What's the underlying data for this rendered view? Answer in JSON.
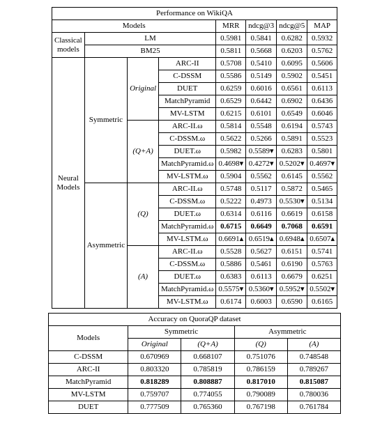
{
  "table1": {
    "title": "Performance on WikiQA",
    "hdr_models": "Models",
    "metrics": {
      "m1": "MRR",
      "m2": "ndcg@3",
      "m3": "ndcg@5",
      "m4": "MAP"
    },
    "classical_group": "Classical\nmodels",
    "neural_group": "Neural\nModels",
    "classical": {
      "lm": {
        "name": "LM",
        "v": [
          "0.5981",
          "0.5841",
          "0.6282",
          "0.5932"
        ]
      },
      "bm25": {
        "name": "BM25",
        "v": [
          "0.5811",
          "0.5668",
          "0.6203",
          "0.5762"
        ]
      }
    },
    "sym_label": "Symmetric",
    "asym_label": "Asymmetric",
    "sub_original": "Original",
    "sub_qa": "(Q+A)",
    "sub_q": "(Q)",
    "sub_a": "(A)",
    "rows": {
      "so_arc": {
        "name": "ARC-II",
        "v": [
          "0.5708",
          "0.5410",
          "0.6095",
          "0.5606"
        ]
      },
      "so_cds": {
        "name": "C-DSSM",
        "v": [
          "0.5586",
          "0.5149",
          "0.5902",
          "0.5451"
        ]
      },
      "so_duet": {
        "name": "DUET",
        "v": [
          "0.6259",
          "0.6016",
          "0.6561",
          "0.6113"
        ]
      },
      "so_mp": {
        "name": "MatchPyramid",
        "v": [
          "0.6529",
          "0.6442",
          "0.6902",
          "0.6436"
        ]
      },
      "so_mv": {
        "name": "MV-LSTM",
        "v": [
          "0.6215",
          "0.6101",
          "0.6549",
          "0.6046"
        ]
      },
      "sqa_arc": {
        "name": "ARC-II.ω",
        "v": [
          "0.5814",
          "0.5548",
          "0.6194",
          "0.5743"
        ]
      },
      "sqa_cds": {
        "name": "C-DSSM.ω",
        "v": [
          "0.5622",
          "0.5266",
          "0.5891",
          "0.5523"
        ]
      },
      "sqa_duet": {
        "name": "DUET.ω",
        "v": [
          "0.5982",
          "0.5589▾",
          "0.6283",
          "0.5801"
        ]
      },
      "sqa_mp": {
        "name": "MatchPyramid.ω",
        "v": [
          "0.4698▾",
          "0.4272▾",
          "0.5202▾",
          "0.4697▾"
        ]
      },
      "sqa_mv": {
        "name": "MV-LSTM.ω",
        "v": [
          "0.5904",
          "0.5562",
          "0.6145",
          "0.5562"
        ]
      },
      "aq_arc": {
        "name": "ARC-II.ω",
        "v": [
          "0.5748",
          "0.5117",
          "0.5872",
          "0.5465"
        ]
      },
      "aq_cds": {
        "name": "C-DSSM.ω",
        "v": [
          "0.5222",
          "0.4973",
          "0.5530▾",
          "0.5134"
        ]
      },
      "aq_duet": {
        "name": "DUET.ω",
        "v": [
          "0.6314",
          "0.6116",
          "0.6619",
          "0.6158"
        ]
      },
      "aq_mp": {
        "name": "MatchPyramid.ω",
        "v": [
          "0.6715",
          "0.6649",
          "0.7068",
          "0.6591"
        ]
      },
      "aq_mv": {
        "name": "MV-LSTM.ω",
        "v": [
          "0.6691▴",
          "0.6519▴",
          "0.6948▴",
          "0.6507▴"
        ]
      },
      "aa_arc": {
        "name": "ARC-II.ω",
        "v": [
          "0.5528",
          "0.5627",
          "0.6151",
          "0.5741"
        ]
      },
      "aa_cds": {
        "name": "C-DSSM.ω",
        "v": [
          "0.5886",
          "0.5461",
          "0.6190",
          "0.5763"
        ]
      },
      "aa_duet": {
        "name": "DUET.ω",
        "v": [
          "0.6383",
          "0.6113",
          "0.6679",
          "0.6251"
        ]
      },
      "aa_mp": {
        "name": "MatchPyramid.ω",
        "v": [
          "0.5575▾",
          "0.5360▾",
          "0.5952▾",
          "0.5502▾"
        ]
      },
      "aa_mv": {
        "name": "MV-LSTM.ω",
        "v": [
          "0.6174",
          "0.6003",
          "0.6590",
          "0.6165"
        ]
      }
    }
  },
  "table2": {
    "title": "Accuracy on QuoraQP dataset",
    "hdr_models": "Models",
    "hdr_sym": "Symmetric",
    "hdr_asym": "Asymmetric",
    "sub_original": "Original",
    "sub_qa": "(Q+A)",
    "sub_q": "(Q)",
    "sub_a": "(A)",
    "rows": {
      "cds": {
        "name": "C-DSSM",
        "v": [
          "0.670969",
          "0.668107",
          "0.751076",
          "0.748548"
        ]
      },
      "arc": {
        "name": "ARC-II",
        "v": [
          "0.803320",
          "0.785819",
          "0.786159",
          "0.789267"
        ]
      },
      "mp": {
        "name": "MatchPyramid",
        "v": [
          "0.818289",
          "0.808887",
          "0.817010",
          "0.815087"
        ]
      },
      "mv": {
        "name": "MV-LSTM",
        "v": [
          "0.759707",
          "0.774055",
          "0.790089",
          "0.780036"
        ]
      },
      "duet": {
        "name": "DUET",
        "v": [
          "0.777509",
          "0.765360",
          "0.767198",
          "0.761784"
        ]
      }
    }
  }
}
